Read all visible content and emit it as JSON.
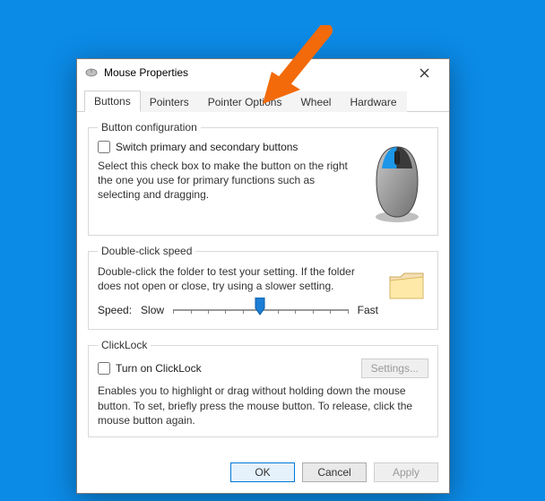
{
  "window": {
    "title": "Mouse Properties"
  },
  "tabs": {
    "items": [
      {
        "label": "Buttons",
        "active": true
      },
      {
        "label": "Pointers",
        "active": false
      },
      {
        "label": "Pointer Options",
        "active": false
      },
      {
        "label": "Wheel",
        "active": false
      },
      {
        "label": "Hardware",
        "active": false
      }
    ]
  },
  "button_config": {
    "legend": "Button configuration",
    "checkbox_label": "Switch primary and secondary buttons",
    "checkbox_checked": false,
    "description": "Select this check box to make the button on the right the one you use for primary functions such as selecting and dragging."
  },
  "double_click": {
    "legend": "Double-click speed",
    "description": "Double-click the folder to test your setting. If the folder does not open or close, try using a slower setting.",
    "speed_label": "Speed:",
    "slow_label": "Slow",
    "fast_label": "Fast",
    "slider_position_percent": 50
  },
  "clicklock": {
    "legend": "ClickLock",
    "checkbox_label": "Turn on ClickLock",
    "checkbox_checked": false,
    "settings_button": "Settings...",
    "settings_enabled": false,
    "description": "Enables you to highlight or drag without holding down the mouse button. To set, briefly press the mouse button. To release, click the mouse button again."
  },
  "footer": {
    "ok": "OK",
    "cancel": "Cancel",
    "apply": "Apply",
    "apply_enabled": false
  },
  "annotation": {
    "arrow_points_to_tab": "Wheel"
  }
}
